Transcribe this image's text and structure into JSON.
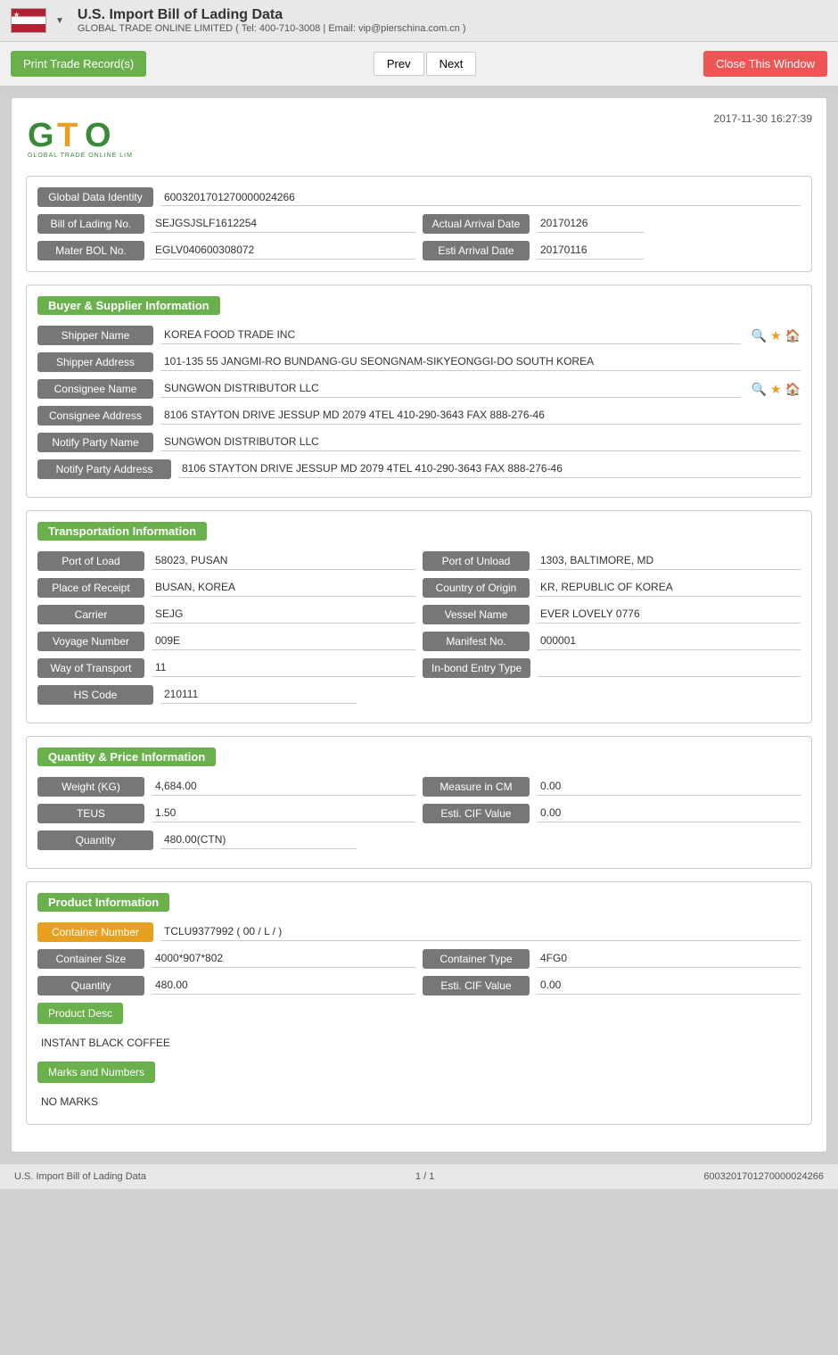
{
  "header": {
    "title": "U.S. Import Bill of Lading Data",
    "subtitle": "GLOBAL TRADE ONLINE LIMITED ( Tel: 400-710-3008 | Email: vip@pierschina.com.cn )"
  },
  "toolbar": {
    "print_label": "Print Trade Record(s)",
    "prev_label": "Prev",
    "next_label": "Next",
    "close_label": "Close This Window"
  },
  "logo": {
    "timestamp": "2017-11-30 16:27:39",
    "company": "GLOBAL TRADE ONLINE LIMITED"
  },
  "basic_info": {
    "global_data_identity_label": "Global Data Identity",
    "global_data_identity_value": "6003201701270000024266",
    "bill_of_lading_label": "Bill of Lading No.",
    "bill_of_lading_value": "SEJGSJSLF1612254",
    "actual_arrival_label": "Actual Arrival Date",
    "actual_arrival_value": "20170126",
    "mater_bol_label": "Mater BOL No.",
    "mater_bol_value": "EGLV040600308072",
    "esti_arrival_label": "Esti Arrival Date",
    "esti_arrival_value": "20170116"
  },
  "buyer_supplier": {
    "section_title": "Buyer & Supplier Information",
    "shipper_name_label": "Shipper Name",
    "shipper_name_value": "KOREA FOOD TRADE INC",
    "shipper_address_label": "Shipper Address",
    "shipper_address_value": "101-135 55 JANGMI-RO BUNDANG-GU SEONGNAM-SIKYEONGGI-DO SOUTH KOREA",
    "consignee_name_label": "Consignee Name",
    "consignee_name_value": "SUNGWON DISTRIBUTOR LLC",
    "consignee_address_label": "Consignee Address",
    "consignee_address_value": "8106 STAYTON DRIVE JESSUP MD 2079 4TEL 410-290-3643 FAX 888-276-46",
    "notify_party_name_label": "Notify Party Name",
    "notify_party_name_value": "SUNGWON DISTRIBUTOR LLC",
    "notify_party_address_label": "Notify Party Address",
    "notify_party_address_value": "8106 STAYTON DRIVE JESSUP MD 2079 4TEL 410-290-3643 FAX 888-276-46"
  },
  "transportation": {
    "section_title": "Transportation Information",
    "port_of_load_label": "Port of Load",
    "port_of_load_value": "58023, PUSAN",
    "port_of_unload_label": "Port of Unload",
    "port_of_unload_value": "1303, BALTIMORE, MD",
    "place_of_receipt_label": "Place of Receipt",
    "place_of_receipt_value": "BUSAN, KOREA",
    "country_of_origin_label": "Country of Origin",
    "country_of_origin_value": "KR, REPUBLIC OF KOREA",
    "carrier_label": "Carrier",
    "carrier_value": "SEJG",
    "vessel_name_label": "Vessel Name",
    "vessel_name_value": "EVER LOVELY 0776",
    "voyage_number_label": "Voyage Number",
    "voyage_number_value": "009E",
    "manifest_no_label": "Manifest No.",
    "manifest_no_value": "000001",
    "way_of_transport_label": "Way of Transport",
    "way_of_transport_value": "11",
    "inbond_entry_label": "In-bond Entry Type",
    "inbond_entry_value": "",
    "hs_code_label": "HS Code",
    "hs_code_value": "210111"
  },
  "quantity_price": {
    "section_title": "Quantity & Price Information",
    "weight_label": "Weight (KG)",
    "weight_value": "4,684.00",
    "measure_label": "Measure in CM",
    "measure_value": "0.00",
    "teus_label": "TEUS",
    "teus_value": "1.50",
    "esti_cif_label": "Esti. CIF Value",
    "esti_cif_value": "0.00",
    "quantity_label": "Quantity",
    "quantity_value": "480.00(CTN)"
  },
  "product_info": {
    "section_title": "Product Information",
    "container_number_label": "Container Number",
    "container_number_value": "TCLU9377992 ( 00 / L / )",
    "container_size_label": "Container Size",
    "container_size_value": "4000*907*802",
    "container_type_label": "Container Type",
    "container_type_value": "4FG0",
    "quantity_label": "Quantity",
    "quantity_value": "480.00",
    "esti_cif_label": "Esti. CIF Value",
    "esti_cif_value": "0.00",
    "product_desc_label": "Product Desc",
    "product_desc_value": "INSTANT BLACK COFFEE",
    "marks_numbers_label": "Marks and Numbers",
    "marks_numbers_value": "NO MARKS"
  },
  "footer": {
    "left": "U.S. Import Bill of Lading Data",
    "center": "1 / 1",
    "right": "6003201701270000024266"
  }
}
